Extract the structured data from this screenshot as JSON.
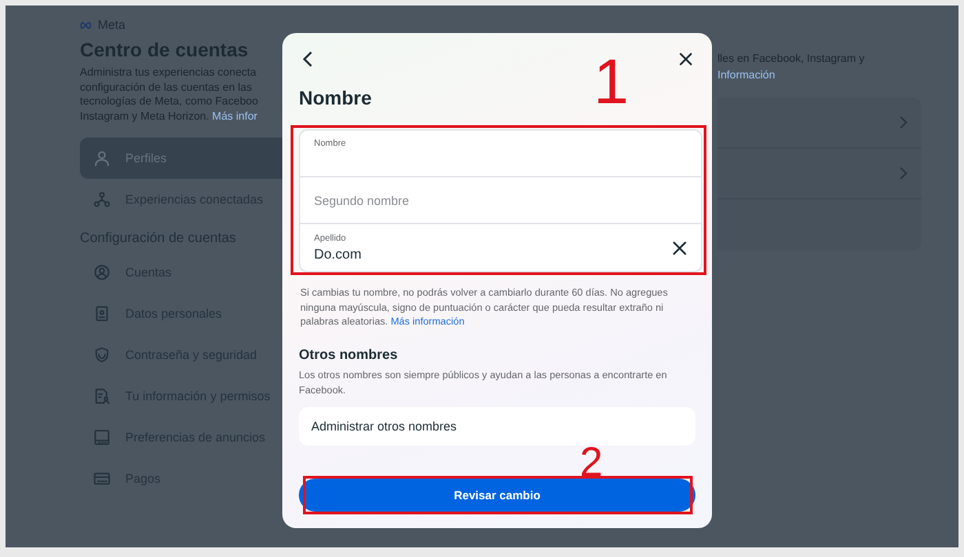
{
  "brand": "Meta",
  "header": {
    "title": "Centro de cuentas",
    "lines": [
      "Administra tus experiencias conecta",
      "configuración de las cuentas en las",
      "tecnologías de Meta, como Faceboo"
    ],
    "last_line": "Instagram y Meta Horizon.",
    "link": "Más infor"
  },
  "sidebar": {
    "items": [
      {
        "label": "Perfiles",
        "selected": true
      },
      {
        "label": "Experiencias conectadas",
        "selected": false
      }
    ],
    "section": "Configuración de cuentas",
    "settings": [
      {
        "label": "Cuentas"
      },
      {
        "label": "Datos personales"
      },
      {
        "label": "Contraseña y seguridad"
      },
      {
        "label": "Tu información y permisos"
      },
      {
        "label": "Preferencias de anuncios"
      },
      {
        "label": "Pagos"
      }
    ]
  },
  "right": {
    "line": "lles en Facebook, Instagram y",
    "link": "Información",
    "rows": [
      {
        "chevron": true
      },
      {
        "chevron": true
      },
      {
        "chevron": false
      }
    ]
  },
  "modal": {
    "title": "Nombre",
    "fields": [
      {
        "kind": "floating",
        "label": "Nombre"
      },
      {
        "kind": "empty",
        "placeholder": "Segundo nombre"
      },
      {
        "kind": "filled",
        "label": "Apellido",
        "value": "Do.com",
        "clearable": true
      }
    ],
    "help": "Si cambias tu nombre, no podrás volver a cambiarlo durante 60 días. No agregues ninguna mayúscula, signo de puntuación o carácter que pueda resultar extraño ni palabras aleatorias.",
    "help_link": "Más información",
    "other_title": "Otros nombres",
    "other_text": "Los otros nombres son siempre públicos y ayudan a las personas a encontrarte en Facebook.",
    "other_action": "Administrar otros nombres",
    "button": "Revisar cambio"
  },
  "annotations": [
    {
      "number": "1"
    },
    {
      "number": "2"
    }
  ]
}
